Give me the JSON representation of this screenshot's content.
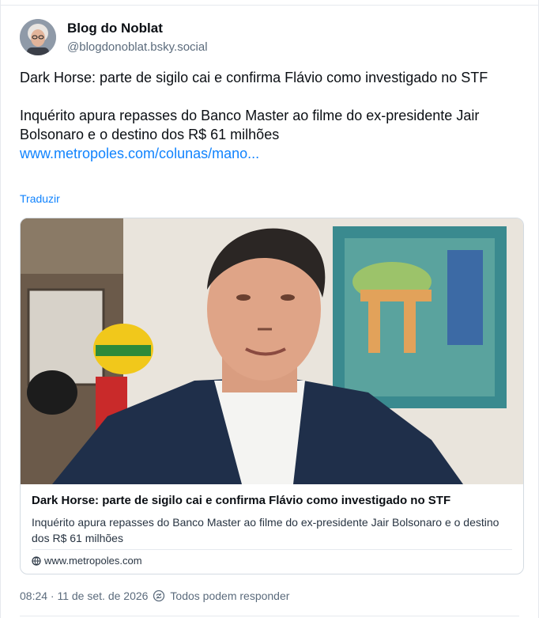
{
  "author": {
    "display_name": "Blog do Noblat",
    "handle": "@blogdonoblat.bsky.social"
  },
  "post": {
    "line1": "Dark Horse: parte de sigilo cai e confirma Flávio como investigado no STF",
    "line2": "Inquérito apura repasses do Banco Master ao filme do ex-presidente Jair Bolsonaro e o destino dos R$ 61 milhões",
    "link_text": "www.metropoles.com/colunas/mano...",
    "translate_label": "Traduzir"
  },
  "embed": {
    "title": "Dark Horse: parte de sigilo cai e confirma Flávio como investigado no STF",
    "description": "Inquérito apura repasses do Banco Master ao filme do ex-presidente Jair Bolsonaro e o destino dos R$ 61 milhões",
    "domain": "www.metropoles.com"
  },
  "footer": {
    "timestamp": "08:24 · 11 de set. de 2026",
    "reply_setting": "Todos podem responder"
  },
  "colors": {
    "link": "#1083fe",
    "text": "#0b0f14",
    "muted": "#5b6b7c"
  },
  "icons": [
    "avatar",
    "globe-icon",
    "reply-settings-icon"
  ]
}
